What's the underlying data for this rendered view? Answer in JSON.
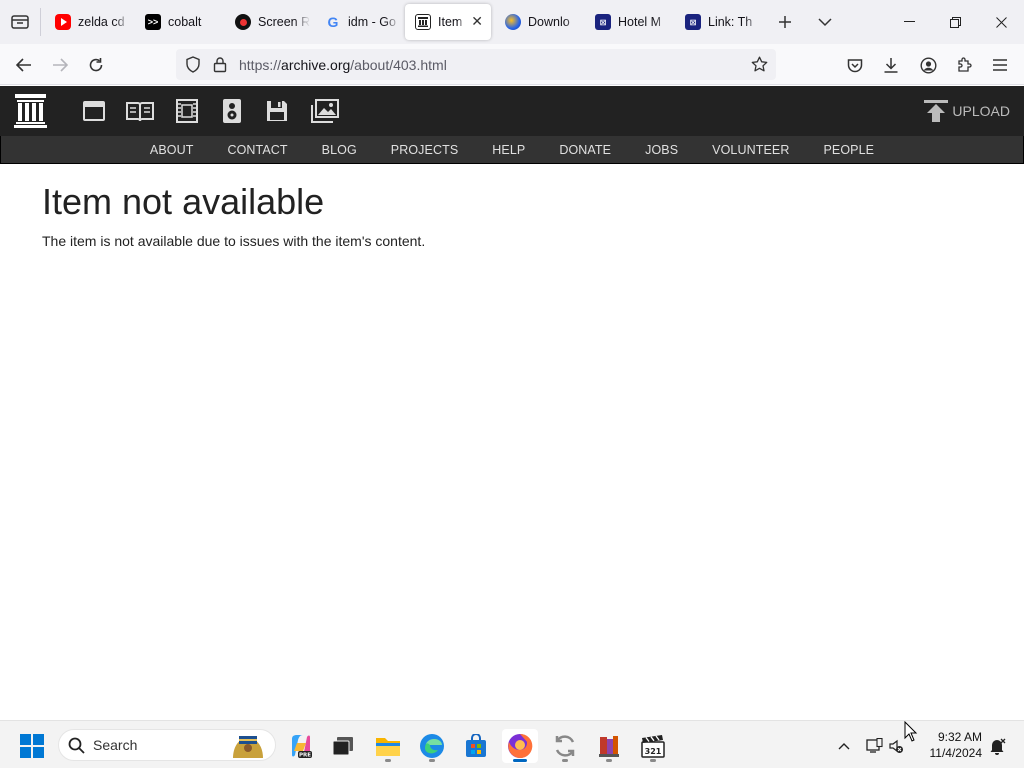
{
  "browser": {
    "tabs": [
      {
        "favicon": "youtube-icon",
        "label": "zelda cd"
      },
      {
        "favicon": "cobalt-icon",
        "label": "cobalt"
      },
      {
        "favicon": "screen-recorder-icon",
        "label": "Screen R"
      },
      {
        "favicon": "google-icon",
        "label": "idm - Go"
      },
      {
        "favicon": "internet-archive-icon",
        "label": "Item n",
        "active": true
      },
      {
        "favicon": "download-globe-icon",
        "label": "Downlo"
      },
      {
        "favicon": "hotel-icon",
        "label": "Hotel M"
      },
      {
        "favicon": "link-site-icon",
        "label": "Link: Th"
      }
    ],
    "url": {
      "scheme": "https://",
      "domain": "archive.org",
      "path": "/about/403.html"
    }
  },
  "site": {
    "nav_links": [
      "ABOUT",
      "CONTACT",
      "BLOG",
      "PROJECTS",
      "HELP",
      "DONATE",
      "JOBS",
      "VOLUNTEER",
      "PEOPLE"
    ],
    "upload_label": "UPLOAD",
    "media_icons": [
      "web-icon",
      "texts-icon",
      "video-icon",
      "audio-icon",
      "software-icon",
      "images-icon"
    ]
  },
  "page": {
    "title": "Item not available",
    "message": "The item is not available due to issues with the item's content."
  },
  "taskbar": {
    "search_label": "Search",
    "time": "9:32 AM",
    "date": "11/4/2024"
  }
}
